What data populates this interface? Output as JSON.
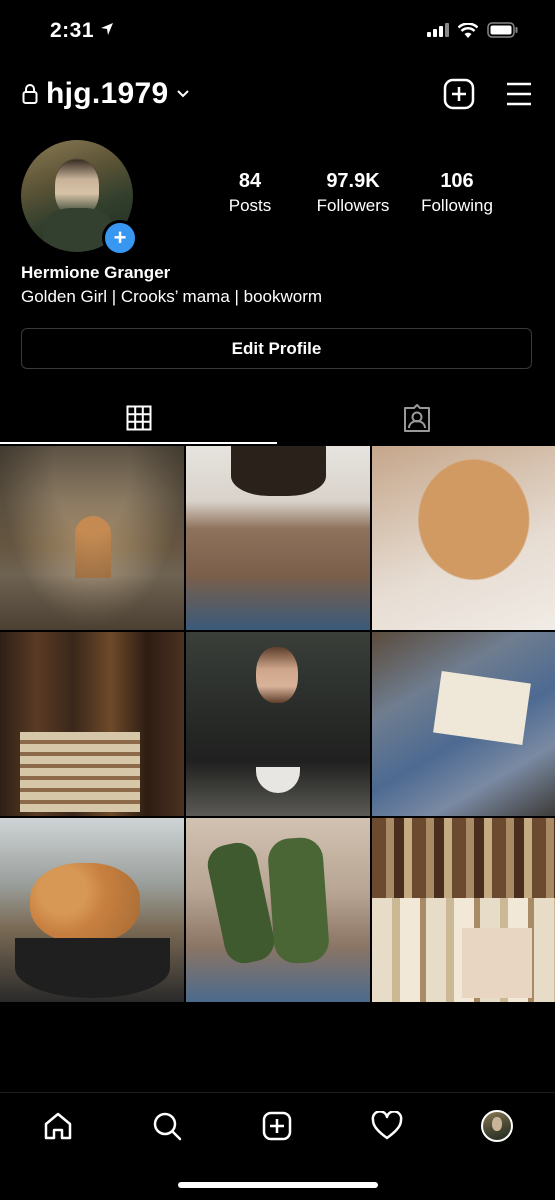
{
  "status_bar": {
    "time": "2:31"
  },
  "header": {
    "username": "hjg.1979"
  },
  "profile": {
    "display_name": "Hermione Granger",
    "bio": "Golden Girl | Crooks’ mama | bookworm",
    "stats": [
      {
        "value": "84",
        "label": "Posts"
      },
      {
        "value": "97.9K",
        "label": "Followers"
      },
      {
        "value": "106",
        "label": "Following"
      }
    ],
    "edit_button": "Edit Profile"
  },
  "tabs": [
    {
      "icon": "grid-icon",
      "active": true
    },
    {
      "icon": "tagged-icon",
      "active": false
    }
  ],
  "posts": [
    {
      "alt": "cloister hallway"
    },
    {
      "alt": "brown knit top"
    },
    {
      "alt": "ginger cat"
    },
    {
      "alt": "library shelves"
    },
    {
      "alt": "girl with cup"
    },
    {
      "alt": "reading in sneakers"
    },
    {
      "alt": "cat in plant pot"
    },
    {
      "alt": "green wool socks"
    },
    {
      "alt": "old books"
    }
  ],
  "bottom_nav": [
    "home-icon",
    "search-icon",
    "new-post-icon",
    "activity-icon",
    "profile-avatar"
  ],
  "colors": {
    "accent": "#3897f0",
    "background": "#000000"
  }
}
